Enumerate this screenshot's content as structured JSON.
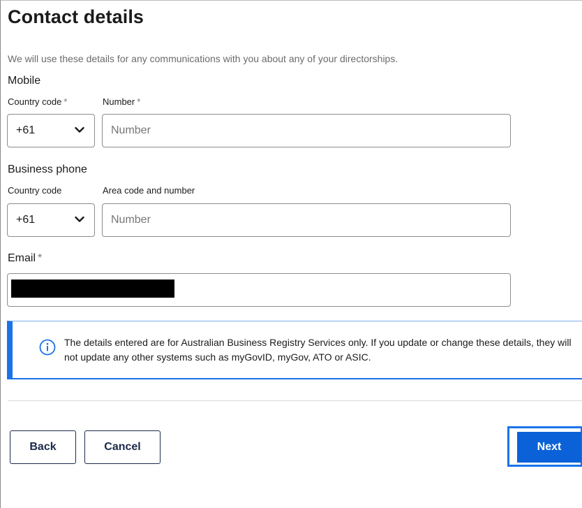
{
  "page": {
    "title": "Contact details",
    "intro": "We will use these details for any communications with you about any of your directorships."
  },
  "mobile": {
    "heading": "Mobile",
    "country_code_label": "Country code",
    "country_code_required": "*",
    "country_code_value": "+61",
    "number_label": "Number",
    "number_required": "*",
    "number_placeholder": "Number"
  },
  "business_phone": {
    "heading": "Business phone",
    "country_code_label": "Country code",
    "country_code_value": "+61",
    "number_label": "Area code and number",
    "number_placeholder": "Number"
  },
  "email": {
    "label": "Email",
    "required": "*"
  },
  "info": {
    "icon": "info-icon",
    "text": "The details entered are for Australian Business Registry Services only. If you update or change these details, they will not update any other systems such as myGovID, myGov, ATO or ASIC."
  },
  "actions": {
    "back_label": "Back",
    "cancel_label": "Cancel",
    "next_label": "Next"
  },
  "colors": {
    "accent": "#1a73e8",
    "primary_button": "#0b62d8",
    "outline_button_text": "#1b2a4a"
  }
}
